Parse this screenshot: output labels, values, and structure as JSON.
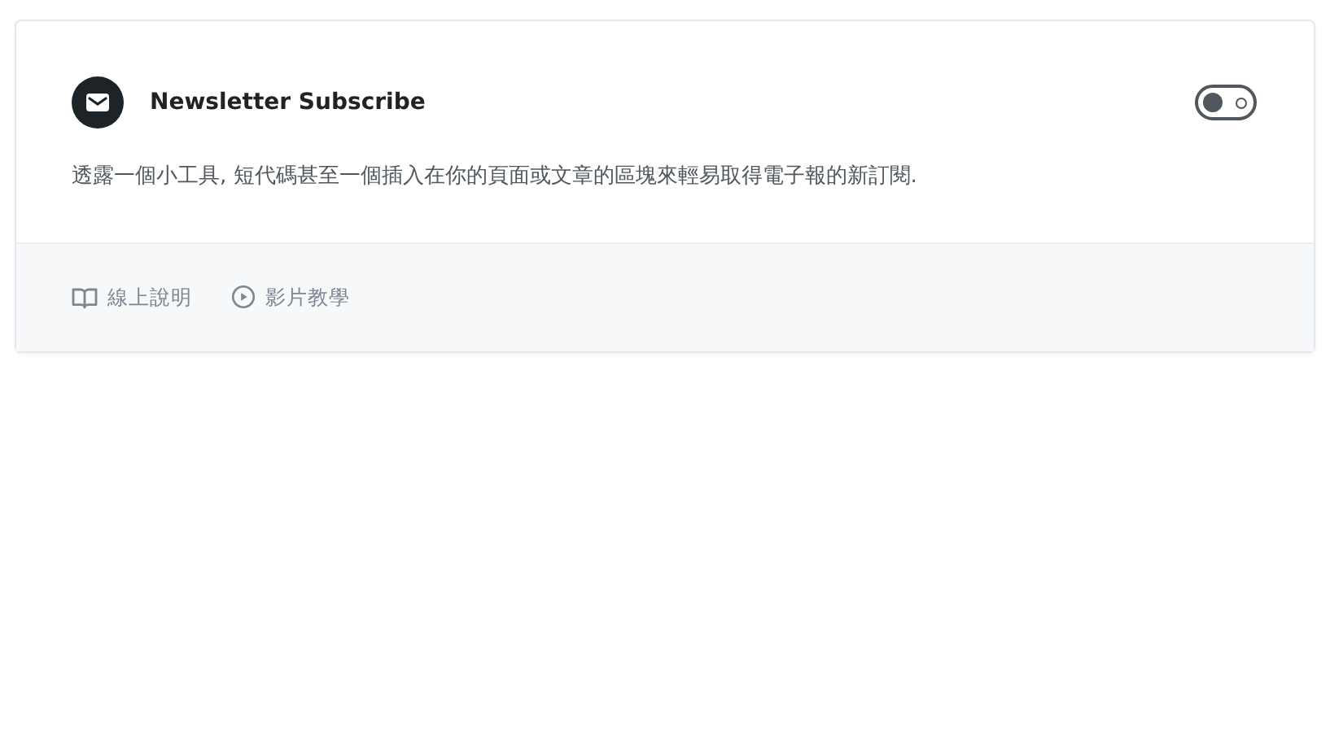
{
  "module": {
    "title": "Newsletter Subscribe",
    "enabled": false,
    "description": "透露一個小工具, 短代碼甚至一個插入在你的頁面或文章的區塊來輕易取得電子報的新訂閱.",
    "links": [
      {
        "kind": "docs",
        "label": "線上說明"
      },
      {
        "kind": "video",
        "label": "影片教學"
      }
    ]
  }
}
